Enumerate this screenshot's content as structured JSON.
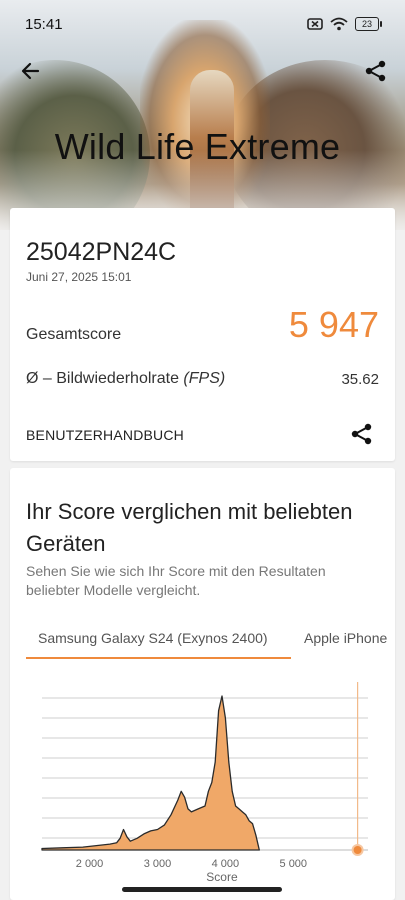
{
  "status": {
    "time": "15:41",
    "battery": "23"
  },
  "hero": {
    "title": "Wild Life Extreme"
  },
  "result": {
    "device": "25042PN24C",
    "date": "Juni 27, 2025 15:01",
    "score_label": "Gesamtscore",
    "score_value": "5 947",
    "fps_label": "Ø – Bildwiederholrate",
    "fps_unit": "(FPS)",
    "fps_value": "35.62",
    "manual_label": "BENUTZERHANDBUCH"
  },
  "comparison": {
    "title": "Ihr Score verglichen mit beliebten Geräten",
    "subtitle": "Sehen Sie wie sich Ihr Score mit den Resultaten beliebter Modelle vergleicht.",
    "tabs": [
      {
        "label": "Samsung Galaxy S24 (Exynos 2400)",
        "active": true
      },
      {
        "label": "Apple iPhone",
        "active": false
      }
    ]
  },
  "colors": {
    "accent": "#ef8a3c",
    "accent_fill": "#f0a868"
  },
  "icons": [
    "back-arrow-icon",
    "share-icon",
    "mute-icon",
    "wifi-icon",
    "battery-icon"
  ],
  "chart_data": {
    "type": "area",
    "xlabel": "Score",
    "x_ticks": [
      "2 000",
      "3 000",
      "4 000",
      "5 000"
    ],
    "x_tick_values": [
      2000,
      3000,
      4000,
      5000
    ],
    "xlim": [
      1300,
      6100
    ],
    "your_score": 5947,
    "series": [
      {
        "x": [
          1300,
          1600,
          1900,
          2100,
          2300,
          2400,
          2450,
          2500,
          2550,
          2600,
          2700,
          2800,
          2900,
          3000,
          3100,
          3200,
          3300,
          3350,
          3400,
          3450,
          3500,
          3600,
          3700,
          3750,
          3800,
          3850,
          3900,
          3950,
          4000,
          4050,
          4100,
          4150,
          4200,
          4250,
          4300,
          4350,
          4400,
          4450,
          4500
        ],
        "y": [
          1,
          1.5,
          2,
          3,
          4,
          5,
          8,
          14,
          9,
          6,
          8,
          11,
          13,
          14,
          17,
          24,
          34,
          40,
          36,
          28,
          26,
          28,
          30,
          40,
          46,
          60,
          95,
          105,
          90,
          60,
          40,
          30,
          28,
          26,
          24,
          20,
          18,
          10,
          0
        ]
      }
    ]
  }
}
